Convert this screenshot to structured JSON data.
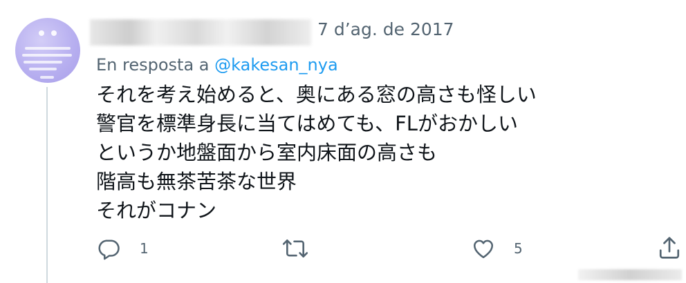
{
  "tweet": {
    "date": "7 d’ag. de 2017",
    "reply_prefix": "En resposta a",
    "reply_handle": "@kakesan_nya",
    "lines": [
      "それを考え始めると、奥にある窓の高さも怪しい",
      "警官を標準身長に当てはめても、FLがおかしい",
      "というか地盤面から室内床面の高さも",
      "階高も無茶苦茶な世界",
      "それがコナン"
    ]
  },
  "actions": {
    "reply": {
      "icon": "reply-icon",
      "count": "1"
    },
    "retweet": {
      "icon": "retweet-icon",
      "count": ""
    },
    "like": {
      "icon": "heart-icon",
      "count": "5"
    },
    "share": {
      "icon": "share-icon",
      "count": ""
    }
  },
  "colors": {
    "text": "#0f1419",
    "secondary": "#536471",
    "link": "#1d9bf0",
    "thread_line": "#cfd9de",
    "avatar": "#b8b0f0"
  }
}
